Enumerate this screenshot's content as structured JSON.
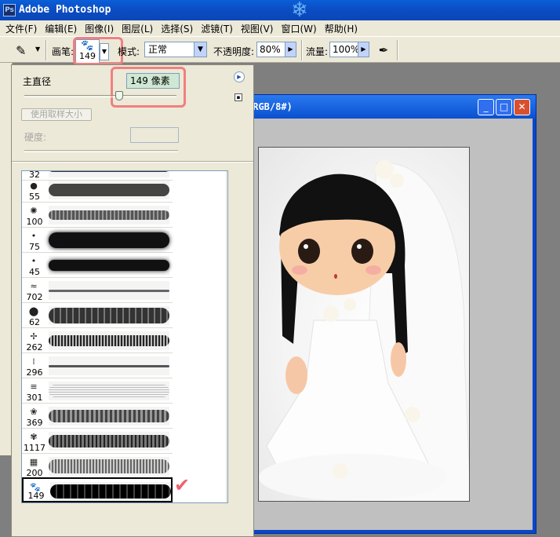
{
  "app": {
    "title": "Adobe Photoshop",
    "icon": "photoshop-app-icon"
  },
  "menu": [
    {
      "label": "文件(F)"
    },
    {
      "label": "编辑(E)"
    },
    {
      "label": "图像(I)"
    },
    {
      "label": "图层(L)"
    },
    {
      "label": "选择(S)"
    },
    {
      "label": "滤镜(T)"
    },
    {
      "label": "视图(V)"
    },
    {
      "label": "窗口(W)"
    },
    {
      "label": "帮助(H)"
    }
  ],
  "options": {
    "brush_label": "画笔:",
    "brush_size": "149",
    "brush_icon": "paw-print-brush",
    "mode_label": "模式:",
    "mode_value": "正常",
    "opacity_label": "不透明度:",
    "opacity_value": "80%",
    "flow_label": "流量:",
    "flow_value": "100%",
    "airbrush_icon": "airbrush-icon"
  },
  "document": {
    "title": "(RGB/8#)"
  },
  "brush_panel": {
    "diameter_label": "主直径",
    "diameter_value": "149 像素",
    "use_sample_size_label": "使用取样大小",
    "hardness_label": "硬度:",
    "presets": [
      {
        "num": "32",
        "kind": "round-hard"
      },
      {
        "num": "55",
        "kind": "round-hard"
      },
      {
        "num": "100",
        "kind": "texture"
      },
      {
        "num": "75",
        "kind": "round-soft"
      },
      {
        "num": "45",
        "kind": "round-soft"
      },
      {
        "num": "702",
        "kind": "texture"
      },
      {
        "num": "62",
        "kind": "round-hard"
      },
      {
        "num": "262",
        "kind": "texture"
      },
      {
        "num": "296",
        "kind": "texture"
      },
      {
        "num": "301",
        "kind": "texture"
      },
      {
        "num": "369",
        "kind": "texture"
      },
      {
        "num": "1117",
        "kind": "texture"
      },
      {
        "num": "200",
        "kind": "texture"
      },
      {
        "num": "149",
        "kind": "paw"
      }
    ],
    "selected_preset": "149"
  },
  "colors": {
    "highlight": "#f08080",
    "titlebar": "#0a5fd8"
  }
}
